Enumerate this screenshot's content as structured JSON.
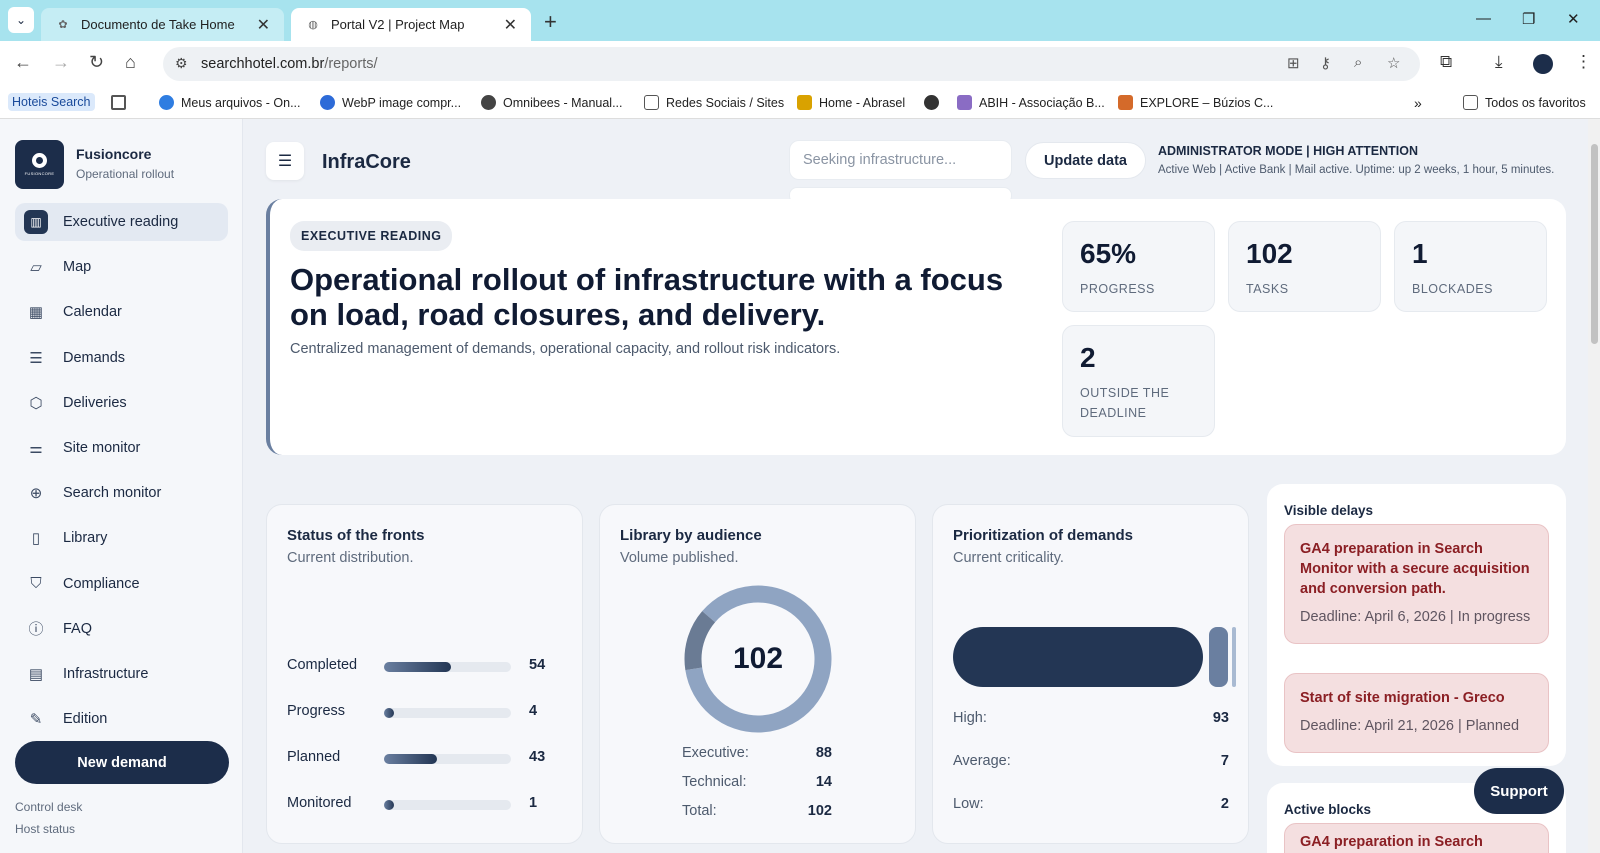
{
  "browser": {
    "tabs": [
      {
        "title": "Documento de Take Home"
      },
      {
        "title": "Portal V2 | Project Map"
      }
    ],
    "url_host": "searchhotel.com.br",
    "url_path": "/reports/",
    "bookmarks": [
      "Hoteis Search",
      "Meus arquivos - On...",
      "WebP image compr...",
      "Omnibees - Manual...",
      "Redes Sociais / Sites",
      "Home - Abrasel",
      "ABIH - Associação B...",
      "EXPLORE – Búzios C...",
      "Todos os favoritos"
    ]
  },
  "sidebar": {
    "brand_name": "Fusioncore",
    "brand_sub": "Operational rollout",
    "logo_text": "FUSIONCORE",
    "items": [
      {
        "label": "Executive reading",
        "icon": "chart-icon"
      },
      {
        "label": "Map",
        "icon": "map-icon"
      },
      {
        "label": "Calendar",
        "icon": "calendar-icon"
      },
      {
        "label": "Demands",
        "icon": "list-icon"
      },
      {
        "label": "Deliveries",
        "icon": "shield-check-icon"
      },
      {
        "label": "Site monitor",
        "icon": "sliders-icon"
      },
      {
        "label": "Search monitor",
        "icon": "search-plus-icon"
      },
      {
        "label": "Library",
        "icon": "book-icon"
      },
      {
        "label": "Compliance",
        "icon": "shield-icon"
      },
      {
        "label": "FAQ",
        "icon": "help-icon"
      },
      {
        "label": "Infrastructure",
        "icon": "server-icon"
      },
      {
        "label": "Edition",
        "icon": "pen-icon"
      }
    ],
    "new_demand": "New demand",
    "footer_1": "Control desk",
    "footer_2": "Host status"
  },
  "topbar": {
    "title": "InfraCore",
    "search_placeholder": "Seeking infrastructure...",
    "update_label": "Update data",
    "admin": "ADMINISTRATOR MODE | HIGH ATTENTION",
    "status": "Active Web | Active Bank | Mail active. Uptime: up 2 weeks, 1 hour, 5 minutes."
  },
  "hero": {
    "badge": "EXECUTIVE READING",
    "headline": "Operational rollout of infrastructure with a focus on load, road closures, and delivery.",
    "sub": "Centralized management of demands, operational capacity, and rollout risk indicators.",
    "kpis": [
      {
        "value": "65%",
        "label": "PROGRESS"
      },
      {
        "value": "102",
        "label": "TASKS"
      },
      {
        "value": "1",
        "label": "BLOCKADES"
      },
      {
        "value": "2",
        "label": "OUTSIDE THE DEADLINE"
      }
    ]
  },
  "fronts": {
    "title": "Status of the fronts",
    "sub": "Current distribution.",
    "rows": [
      {
        "label": "Completed",
        "value": 54,
        "fraction": 0.53
      },
      {
        "label": "Progress",
        "value": 4,
        "fraction": 0.04
      },
      {
        "label": "Planned",
        "value": 43,
        "fraction": 0.42
      },
      {
        "label": "Monitored",
        "value": 1,
        "fraction": 0.01
      }
    ]
  },
  "library": {
    "title": "Library by audience",
    "sub": "Volume published.",
    "total_center": "102",
    "rows": [
      {
        "label": "Executive:",
        "value": "88"
      },
      {
        "label": "Technical:",
        "value": "14"
      },
      {
        "label": "Total:",
        "value": "102"
      }
    ],
    "segments": [
      {
        "value": 88,
        "color": "#8fa4c2"
      },
      {
        "value": 14,
        "color": "#6a7b94"
      }
    ]
  },
  "priority": {
    "title": "Prioritization of demands",
    "sub": "Current criticality.",
    "rows": [
      {
        "label": "High:",
        "value": "93"
      },
      {
        "label": "Average:",
        "value": "7"
      },
      {
        "label": "Low:",
        "value": "2"
      }
    ]
  },
  "delays": {
    "title": "Visible delays",
    "items": [
      {
        "title": "GA4 preparation in Search Monitor with a secure acquisition and conversion path.",
        "detail": "Deadline: April 6, 2026 | In progress"
      },
      {
        "title": "Start of site migration - Greco",
        "detail": "Deadline: April 21, 2026 | Planned"
      }
    ]
  },
  "blocks": {
    "title": "Active blocks",
    "item": "GA4 preparation in Search"
  },
  "support": "Support",
  "colors": {
    "navy": "#1c2d4a",
    "accent": "#6a7fa0",
    "delay_bg": "#f4dfe0",
    "delay_text": "#8b1f24"
  }
}
